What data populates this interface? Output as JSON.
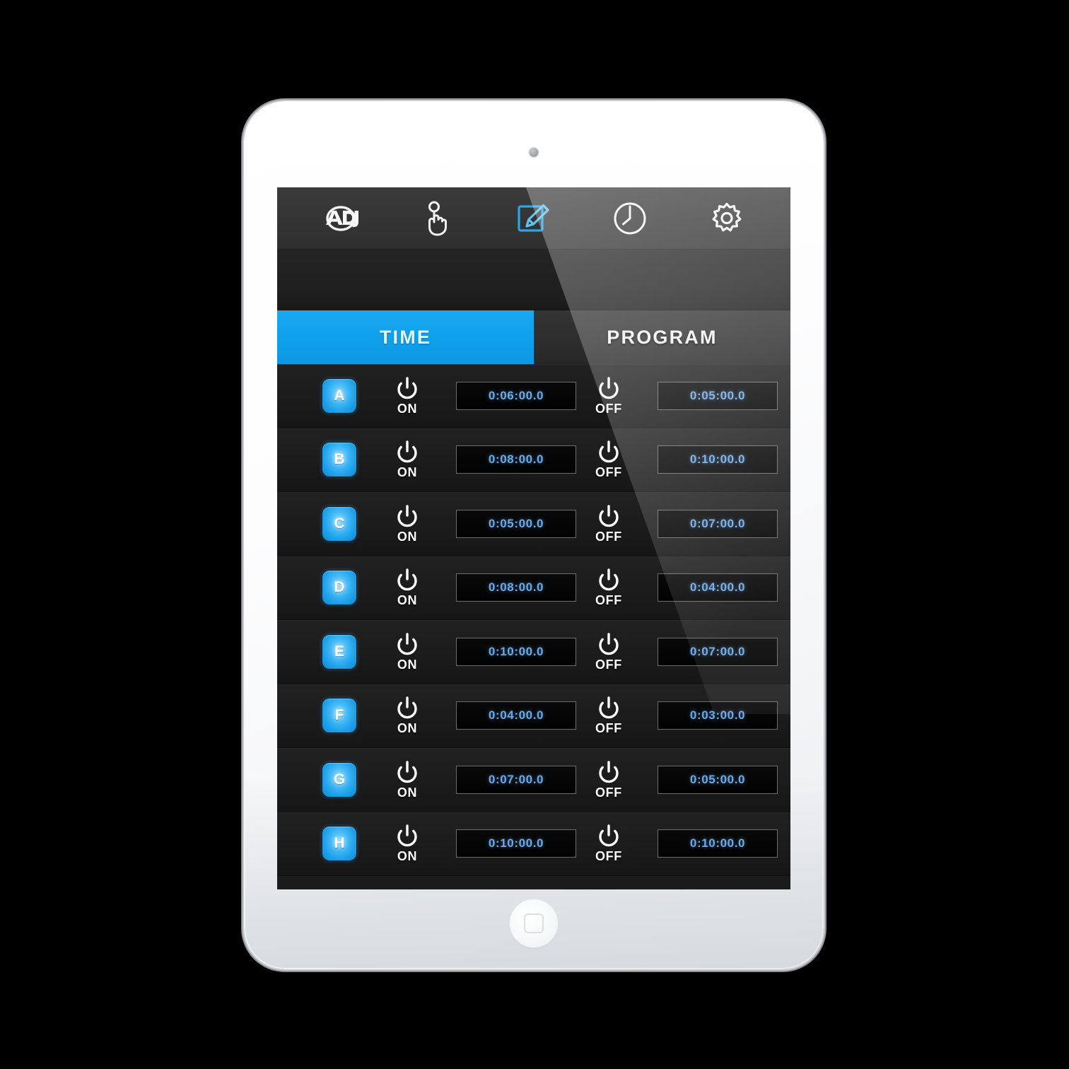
{
  "app": {
    "brand": "ADJ",
    "accent_blue": "#0FA0EC",
    "screen_bg": "#1b1b1b"
  },
  "toolbar": {
    "items": [
      {
        "name": "adj-logo-icon",
        "label": "ADJ",
        "active": false
      },
      {
        "name": "touch-icon",
        "label": "Touch",
        "active": false
      },
      {
        "name": "edit-pencil-icon",
        "label": "Edit",
        "active": true
      },
      {
        "name": "clock-icon",
        "label": "Clock",
        "active": false
      },
      {
        "name": "gear-icon",
        "label": "Settings",
        "active": false
      }
    ]
  },
  "tabs": [
    {
      "label": "TIME",
      "active": true
    },
    {
      "label": "PROGRAM",
      "active": false
    }
  ],
  "labels": {
    "on": "ON",
    "off": "OFF"
  },
  "rows": [
    {
      "channel": "A",
      "on_time": "0:06:00.0",
      "off_time": "0:05:00.0"
    },
    {
      "channel": "B",
      "on_time": "0:08:00.0",
      "off_time": "0:10:00.0"
    },
    {
      "channel": "C",
      "on_time": "0:05:00.0",
      "off_time": "0:07:00.0"
    },
    {
      "channel": "D",
      "on_time": "0:08:00.0",
      "off_time": "0:04:00.0"
    },
    {
      "channel": "E",
      "on_time": "0:10:00.0",
      "off_time": "0:07:00.0"
    },
    {
      "channel": "F",
      "on_time": "0:04:00.0",
      "off_time": "0:03:00.0"
    },
    {
      "channel": "G",
      "on_time": "0:07:00.0",
      "off_time": "0:05:00.0"
    },
    {
      "channel": "H",
      "on_time": "0:10:00.0",
      "off_time": "0:10:00.0"
    }
  ]
}
